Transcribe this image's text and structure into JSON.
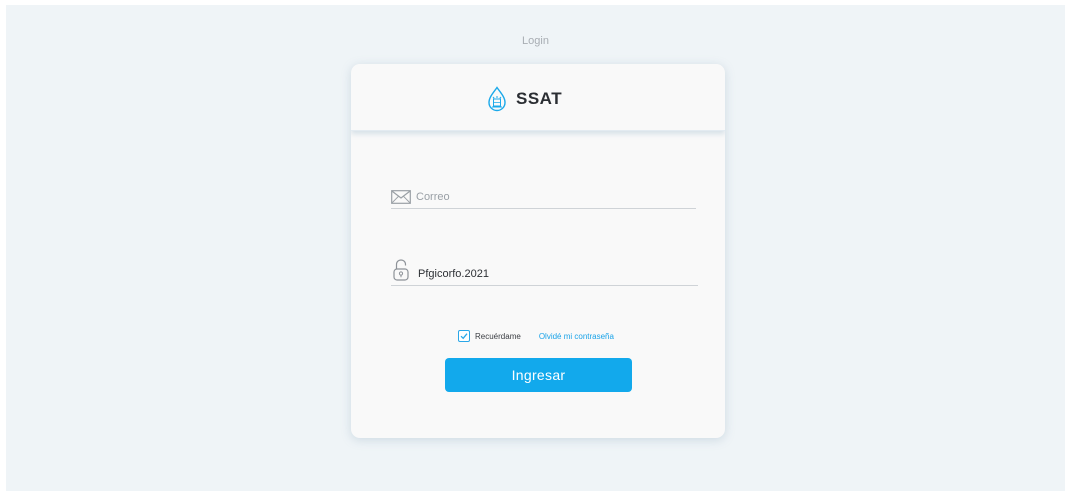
{
  "page": {
    "title": "Login"
  },
  "brand": {
    "name": "SSAT",
    "logo_icon": "water-drop-logo-icon"
  },
  "form": {
    "email": {
      "icon": "envelope-icon",
      "placeholder": "Correo",
      "value": ""
    },
    "password": {
      "icon": "unlocked-padlock-icon",
      "value": "Pfgicorfo.2021"
    },
    "remember": {
      "label": "Recuérdame",
      "checked": true
    },
    "forgot_link": "Olvidé mi contraseña",
    "submit_label": "Ingresar"
  },
  "colors": {
    "accent": "#12a9ec",
    "link": "#1aa3e8",
    "page_background": "#eff4f7",
    "card_background": "#f9f9f9"
  }
}
